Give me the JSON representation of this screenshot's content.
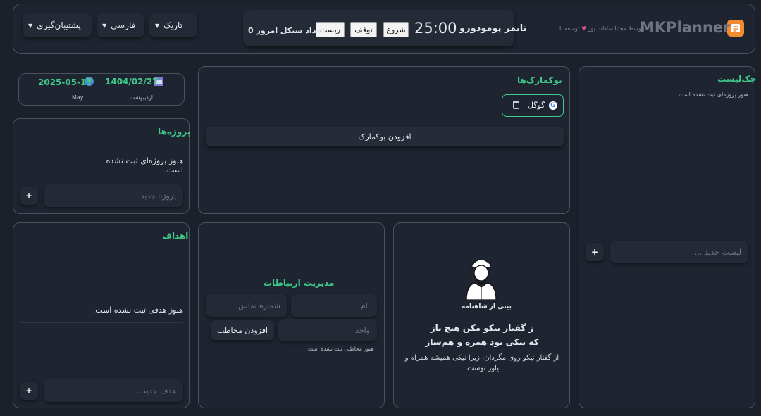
{
  "header": {
    "app_name": "MKPlanner",
    "credit_prefix": "توسعه با",
    "credit_suffix": "توسط مجتبا سادات پور",
    "heart": "♥",
    "logo_icon": "planner-logo-icon",
    "pomodoro_title": "تایمر پومودورو",
    "timer_value": "25:00",
    "start_label": "شروع",
    "pause_label": "توقف",
    "reset_label": "ریست",
    "cycle_label": "تعداد سیکل امروز:",
    "cycle_count": "0",
    "theme_select": "تاریک",
    "language_select": "فارسی",
    "support_select": "پشتیبان‌گیری"
  },
  "date": {
    "jalali": "1404/02/27",
    "jalali_month": "اردیبهشت",
    "gregorian": "2025-05-17",
    "gregorian_month": "May"
  },
  "projects": {
    "title": "پروژه‌ها",
    "empty": "هنوز پروژه‌ای ثبت نشده است.",
    "placeholder": "پروژه جدید...",
    "add": "+"
  },
  "bookmarks": {
    "title": "بوکمارک‌ها",
    "items": [
      {
        "label": "گوگل",
        "icon": "google-icon"
      }
    ],
    "add_label": "افزودن بوکمارک"
  },
  "checklist": {
    "title": "چک‌لیست",
    "empty": "هنوز پروژه‌ای ثبت نشده است.",
    "placeholder": "لیست جدید ...",
    "add": "+"
  },
  "goals": {
    "title": "اهداف",
    "empty": "هنوز هدفی ثبت نشده است.",
    "placeholder": "هدف جدید...",
    "add": "+"
  },
  "contacts": {
    "title": "مدیریت ارتباطات",
    "name_placeholder": "نام",
    "phone_placeholder": "شماره تماس",
    "unit_placeholder": "واحد",
    "add_label": "افزودن مخاطب",
    "empty": "هنوز مخاطبی ثبت نشده است."
  },
  "shahnameh": {
    "caption": "بیتی از شاهنامه",
    "verse_line1": "ز گفتار نیکو مکن هیچ باز",
    "verse_line2": "که نیکی بود همره و هم‌ساز",
    "explanation": "از گفتار نیکو روی مگردان، زیرا نیکی همیشه همراه و یاور توست."
  },
  "colors": {
    "accent": "#3ecb8a",
    "background": "#1b212b",
    "panel_border": "#4a5260"
  }
}
